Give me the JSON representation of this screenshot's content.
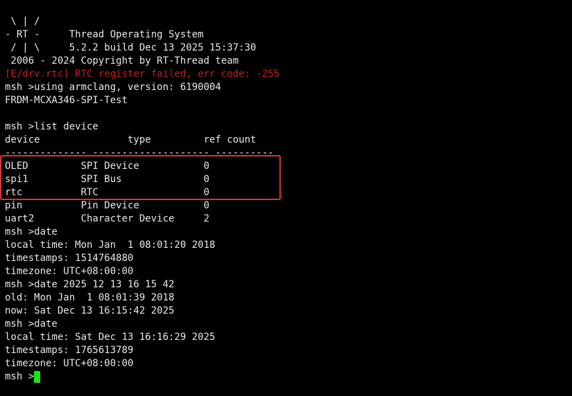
{
  "terminal": {
    "lines": [
      " \\ | /",
      "- RT -     Thread Operating System",
      " / | \\     5.2.2 build Dec 13 2025 15:37:30",
      " 2006 - 2024 Copyright by RT-Thread team",
      "[E/drv.rtc] RTC register failed, err code: -255",
      "msh >using armclang, version: 6190004",
      "FRDM-MCXA346-SPI-Test",
      "",
      "msh >list device",
      "device               type         ref count",
      "-------------- -------------------- ----------",
      "OLED         SPI Device           0",
      "spi1         SPI Bus              0",
      "rtc          RTC                  0",
      "pin          Pin Device           0",
      "uart2        Character Device     2",
      "msh >date",
      "local time: Mon Jan  1 08:01:20 2018",
      "timestamps: 1514764880",
      "timezone: UTC+08:00:00",
      "msh >date 2025 12 13 16 15 42",
      "old: Mon Jan  1 08:01:39 2018",
      "now: Sat Dec 13 16:15:42 2025",
      "msh >date",
      "local time: Sat Dec 13 16:16:29 2025",
      "timestamps: 1765613789",
      "timezone: UTC+08:00:00"
    ],
    "prompt": "msh >",
    "colors": {
      "background": "#000000",
      "text": "#e8e8e8",
      "error": "#c81e1e",
      "cursor": "#19e619",
      "highlight_border": "#e03232"
    }
  }
}
